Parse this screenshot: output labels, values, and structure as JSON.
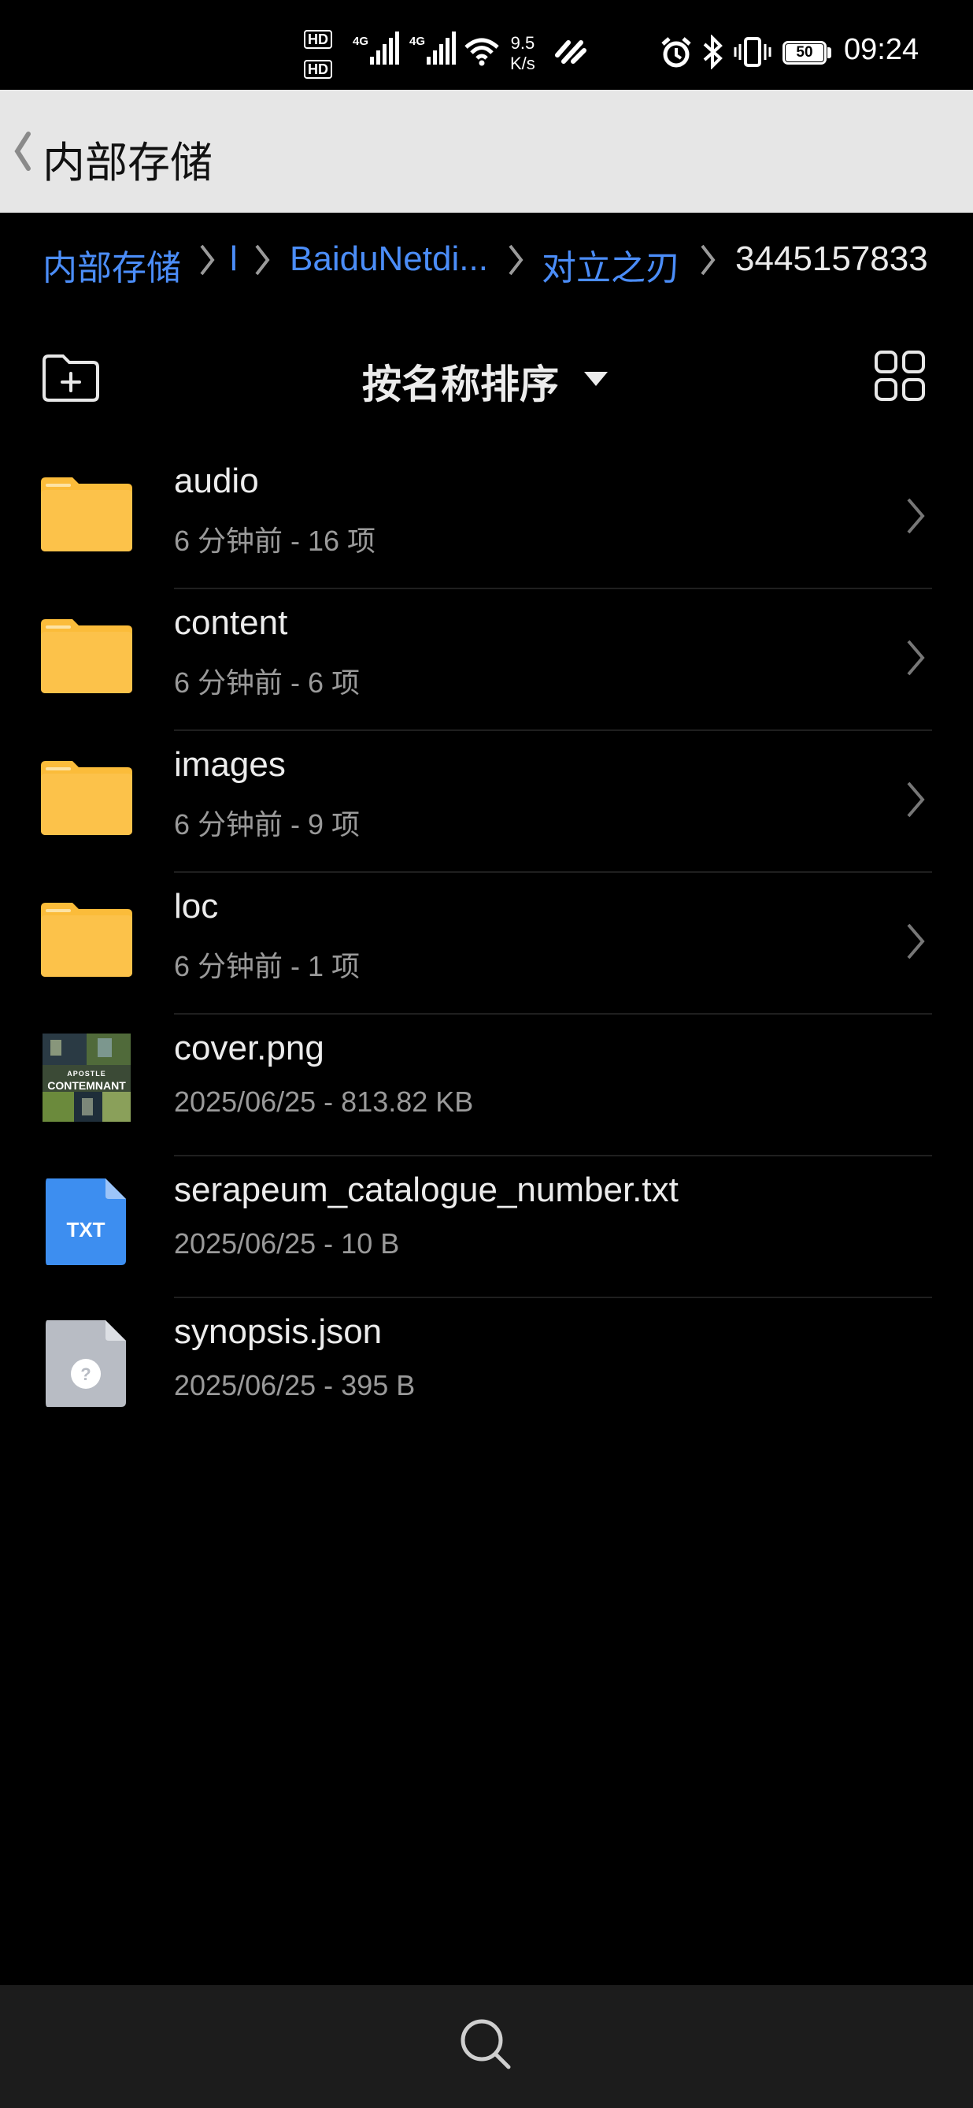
{
  "status_bar": {
    "hd1": "HD",
    "hd2": "HD",
    "net1": "4G",
    "net2": "4G",
    "speed_value": "9.5",
    "speed_unit": "K/s",
    "battery": "50",
    "time": "09:24",
    "icons": [
      "hd-icon",
      "signal-icon",
      "wifi-icon",
      "vpn-icon",
      "alarm-icon",
      "bluetooth-icon",
      "vibrate-icon",
      "battery-icon"
    ]
  },
  "header": {
    "title": "内部存储"
  },
  "breadcrumb": {
    "items": [
      "内部存储",
      "l",
      "BaiduNetdi...",
      "对立之刃",
      "3445157833"
    ]
  },
  "toolbar": {
    "sort_label": "按名称排序"
  },
  "files": [
    {
      "name": "audio",
      "meta": "6 分钟前 - 16 项",
      "type": "folder"
    },
    {
      "name": "content",
      "meta": "6 分钟前 - 6 项",
      "type": "folder"
    },
    {
      "name": "images",
      "meta": "6 分钟前 - 9 项",
      "type": "folder"
    },
    {
      "name": "loc",
      "meta": "6 分钟前 - 1 项",
      "type": "folder"
    },
    {
      "name": "cover.png",
      "meta": "2025/06/25 - 813.82 KB",
      "type": "image",
      "thumb_text_1": "APOSTLE",
      "thumb_text_2": "CONTEMNANT"
    },
    {
      "name": "serapeum_catalogue_number.txt",
      "meta": "2025/06/25 - 10 B",
      "type": "txt",
      "icon_label": "TXT"
    },
    {
      "name": "synopsis.json",
      "meta": "2025/06/25 - 395 B",
      "type": "unknown",
      "icon_label": "?"
    }
  ],
  "colors": {
    "background": "#000000",
    "title_bar": "#e6e6e6",
    "link": "#4b8df8",
    "folder": "#fbbc3a",
    "txt_icon": "#3d8ef0",
    "unknown_icon": "#b8bcc4",
    "bottom_bar": "#1c1c1c"
  }
}
